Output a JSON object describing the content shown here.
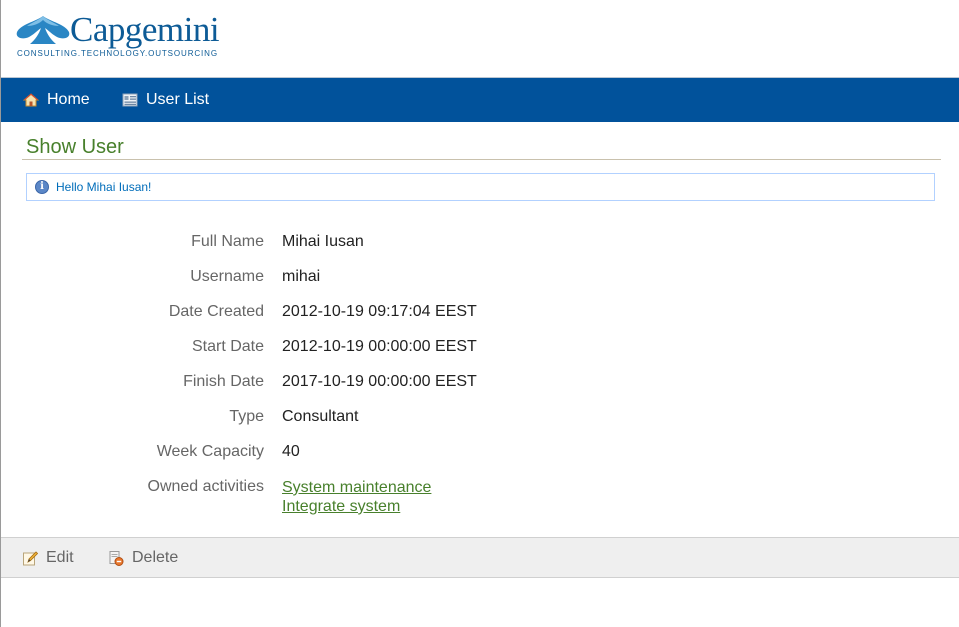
{
  "brand": {
    "name": "Capgemini",
    "tagline": "CONSULTING.TECHNOLOGY.OUTSOURCING"
  },
  "nav": {
    "home_label": "Home",
    "user_list_label": "User List"
  },
  "page": {
    "title": "Show User"
  },
  "message": {
    "text": "Hello Mihai Iusan!"
  },
  "user": {
    "fields": [
      {
        "label": "Full Name",
        "value": "Mihai Iusan"
      },
      {
        "label": "Username",
        "value": "mihai"
      },
      {
        "label": "Date Created",
        "value": "2012-10-19 09:17:04 EEST"
      },
      {
        "label": "Start Date",
        "value": "2012-10-19 00:00:00 EEST"
      },
      {
        "label": "Finish Date",
        "value": "2017-10-19 00:00:00 EEST"
      },
      {
        "label": "Type",
        "value": "Consultant"
      },
      {
        "label": "Week Capacity",
        "value": "40"
      }
    ],
    "owned_activities_label": "Owned activities",
    "owned_activities": [
      "System maintenance",
      "Integrate system"
    ]
  },
  "actions": {
    "edit_label": "Edit",
    "delete_label": "Delete"
  },
  "colors": {
    "nav_bg": "#01529b",
    "title": "#48802c",
    "link": "#48802c",
    "message_border": "#b2d1ff",
    "message_text": "#006dba"
  }
}
